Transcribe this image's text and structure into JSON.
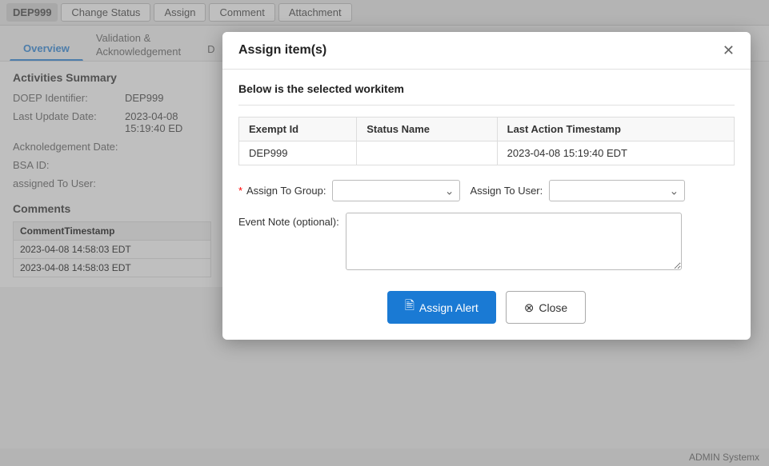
{
  "toolbar": {
    "id_label": "DEP999",
    "buttons": [
      {
        "label": "Change Status",
        "name": "change-status-button"
      },
      {
        "label": "Assign",
        "name": "assign-button"
      },
      {
        "label": "Comment",
        "name": "comment-button"
      },
      {
        "label": "Attachment",
        "name": "attachment-button"
      }
    ]
  },
  "tabs": [
    {
      "label": "Overview",
      "active": true,
      "multiline": false
    },
    {
      "label": "Validation &\nAcknowledgement",
      "active": false,
      "multiline": true
    },
    {
      "label": "D",
      "active": false,
      "multiline": false
    }
  ],
  "sidebar": {
    "section_title": "Activities Summary",
    "fields": [
      {
        "label": "DOEP Identifier:",
        "value": "DEP999"
      },
      {
        "label": "Last Update Date:",
        "value": "2023-04-08 15:19:40 ED"
      },
      {
        "label": "Acknoledgement Date:",
        "value": ""
      },
      {
        "label": "BSA ID:",
        "value": ""
      },
      {
        "label": "assigned To User:",
        "value": ""
      }
    ],
    "comments": {
      "title": "Comments",
      "columns": [
        "CommentTimestamp"
      ],
      "rows": [
        [
          "2023-04-08 14:58:03 EDT"
        ],
        [
          "2023-04-08 14:58:03 EDT"
        ]
      ]
    }
  },
  "modal": {
    "title": "Assign item(s)",
    "close_label": "✕",
    "section_label": "Below is the selected workitem",
    "table": {
      "columns": [
        "Exempt Id",
        "Status Name",
        "Last Action Timestamp"
      ],
      "rows": [
        {
          "exempt_id": "DEP999",
          "status_name": "",
          "last_action": "2023-04-08 15:19:40 EDT"
        }
      ]
    },
    "form": {
      "assign_group_label": "Assign To Group:",
      "assign_group_placeholder": "",
      "assign_user_label": "Assign To User:",
      "assign_user_placeholder": "",
      "event_note_label": "Event Note (optional):",
      "event_note_value": ""
    },
    "buttons": {
      "assign_label": "Assign Alert",
      "assign_icon": "🖹",
      "close_label": "Close",
      "close_icon": "⊗"
    }
  },
  "footer": {
    "text": "ADMIN Systemx"
  }
}
